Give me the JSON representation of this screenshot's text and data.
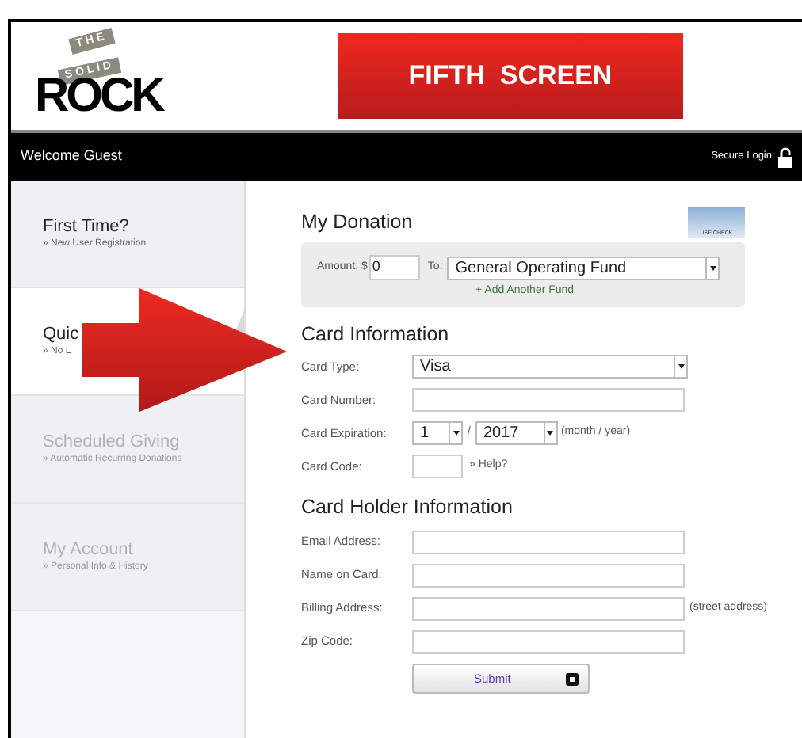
{
  "header": {
    "logo": {
      "top": "THE",
      "middle": "SOLID",
      "bottom": "ROCK"
    },
    "banner": "FIFTH  SCREEN"
  },
  "nav_bar": {
    "greeting": "Welcome Guest",
    "login": "Secure Login"
  },
  "sidebar": {
    "items": [
      {
        "title": "First Time?",
        "subtitle": "» New User Registration",
        "selected": false,
        "disabled": false
      },
      {
        "title": "Quic",
        "subtitle": "» No L",
        "selected": true,
        "disabled": false
      },
      {
        "title": "Scheduled Giving",
        "subtitle": "» Automatic Recurring Donations",
        "selected": false,
        "disabled": true
      },
      {
        "title": "My Account",
        "subtitle": "» Personal Info & History",
        "selected": false,
        "disabled": true
      }
    ]
  },
  "donation": {
    "title": "My Donation",
    "check_label": "USE CHECK",
    "amount_label": "Amount: $",
    "amount": "0",
    "to_label": "To:",
    "fund": "General Operating Fund",
    "add_link": "+ Add Another Fund"
  },
  "card_info": {
    "title": "Card Information",
    "rows": [
      {
        "kind": "select",
        "label": "Card Type:",
        "value": "Visa"
      },
      {
        "kind": "text",
        "label": "Card Number:"
      },
      {
        "kind": "expiry",
        "label": "Card Expiration:",
        "month": "1",
        "separator": "/",
        "year": "2017",
        "note": "(month / year)"
      },
      {
        "kind": "code",
        "label": "Card Code:",
        "note": "» Help?"
      }
    ]
  },
  "holder": {
    "title": "Card Holder Information",
    "rows": [
      {
        "label": "Email Address:"
      },
      {
        "label": "Name on Card:"
      },
      {
        "label": "Billing Address:",
        "note": "(street address)"
      },
      {
        "label": "Zip Code:"
      }
    ]
  },
  "submit": "Submit"
}
